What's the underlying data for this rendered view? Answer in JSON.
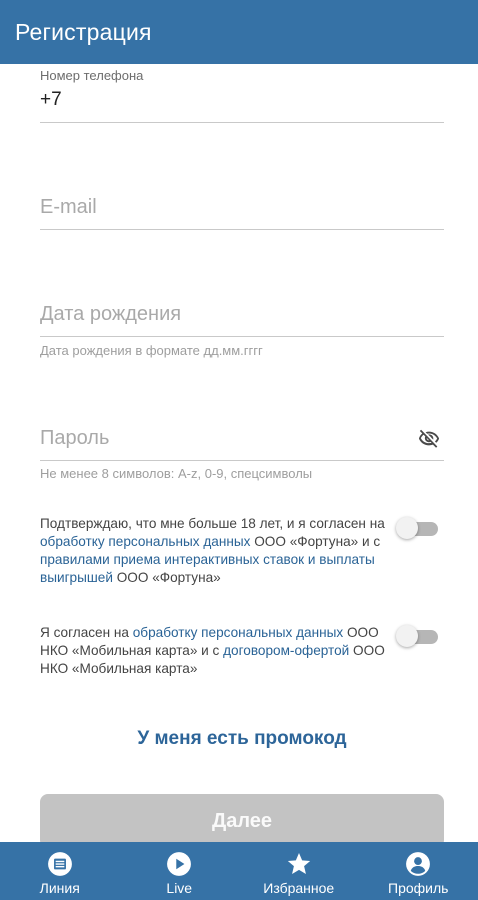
{
  "header": {
    "title": "Регистрация"
  },
  "form": {
    "phone": {
      "label": "Номер телефона",
      "value": "+7"
    },
    "email": {
      "placeholder": "E-mail"
    },
    "birthdate": {
      "placeholder": "Дата рождения",
      "helper": "Дата рождения в формате дд.мм.гггг"
    },
    "password": {
      "placeholder": "Пароль",
      "helper": "Не менее 8 символов: A-z, 0-9, спецсимволы",
      "icon": "eye-off-icon"
    }
  },
  "consents": [
    {
      "text_1": "Подтверждаю, что мне больше 18 лет, и я согласен на ",
      "link_1": "обработку персональных данных",
      "text_2": " ООО «Фортуна» и с ",
      "link_2": "правилами приема интерактивных ставок и выплаты выигрышей",
      "text_3": " ООО «Фортуна»",
      "checked": false
    },
    {
      "text_1": "Я согласен на ",
      "link_1": "обработку персональных данных",
      "text_2": " ООО НКО «Мобильная карта» и с ",
      "link_2": "договором-офертой",
      "text_3": " ООО НКО «Мобильная карта»",
      "checked": false
    }
  ],
  "promo": {
    "label": "У меня есть промокод"
  },
  "next_button": {
    "label": "Далее",
    "enabled": false
  },
  "bottom_nav": [
    {
      "label": "Линия",
      "icon": "line-icon"
    },
    {
      "label": "Live",
      "icon": "play-icon"
    },
    {
      "label": "Избранное",
      "icon": "star-icon"
    },
    {
      "label": "Профиль",
      "icon": "profile-icon"
    }
  ],
  "colors": {
    "primary": "#3672a6",
    "link": "#2a6396",
    "disabled_button": "#c3c3c3"
  }
}
